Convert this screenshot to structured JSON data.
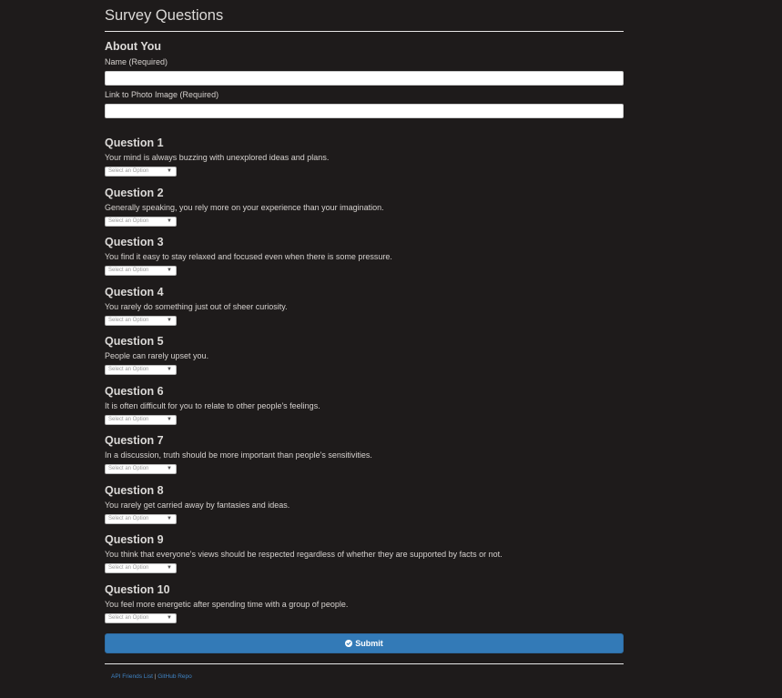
{
  "page": {
    "title": "Survey Questions"
  },
  "about": {
    "heading": "About You",
    "name_label": "Name (Required)",
    "name_value": "",
    "photo_label": "Link to Photo Image (Required)",
    "photo_value": ""
  },
  "questions": [
    {
      "title": "Question 1",
      "text": "Your mind is always buzzing with unexplored ideas and plans.",
      "select": "Select an Option"
    },
    {
      "title": "Question 2",
      "text": "Generally speaking, you rely more on your experience than your imagination.",
      "select": "Select an Option"
    },
    {
      "title": "Question 3",
      "text": "You find it easy to stay relaxed and focused even when there is some pressure.",
      "select": "Select an Option"
    },
    {
      "title": "Question 4",
      "text": "You rarely do something just out of sheer curiosity.",
      "select": "Select an Option"
    },
    {
      "title": "Question 5",
      "text": "People can rarely upset you.",
      "select": "Select an Option"
    },
    {
      "title": "Question 6",
      "text": "It is often difficult for you to relate to other people's feelings.",
      "select": "Select an Option"
    },
    {
      "title": "Question 7",
      "text": "In a discussion, truth should be more important than people's sensitivities.",
      "select": "Select an Option"
    },
    {
      "title": "Question 8",
      "text": "You rarely get carried away by fantasies and ideas.",
      "select": "Select an Option"
    },
    {
      "title": "Question 9",
      "text": "You think that everyone's views should be respected regardless of whether they are supported by facts or not.",
      "select": "Select an Option"
    },
    {
      "title": "Question 10",
      "text": "You feel more energetic after spending time with a group of people.",
      "select": "Select an Option"
    }
  ],
  "submit": {
    "label": "Submit",
    "icon": "check-circle-icon",
    "color": "#337ab7"
  },
  "footer": {
    "link1": "API Friends List",
    "separator": " | ",
    "link2": "GitHub Repo"
  },
  "colors": {
    "background": "#1e1b1b",
    "text": "#d6d2cf",
    "link": "#3f84c6"
  }
}
